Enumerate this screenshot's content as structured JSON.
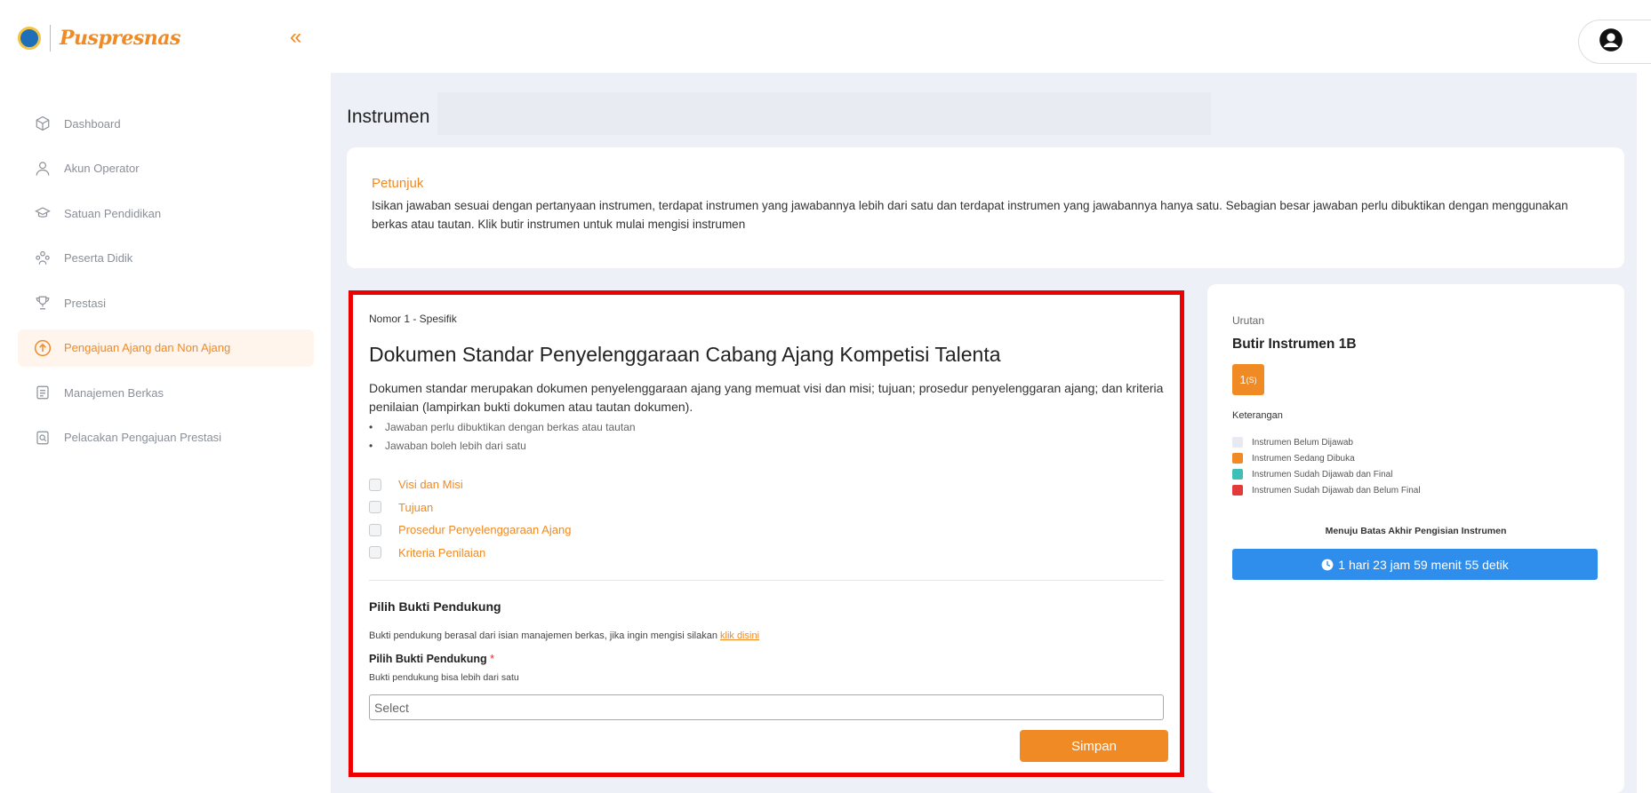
{
  "brand": {
    "name": "Puspresnas"
  },
  "nav": {
    "items": [
      {
        "label": "Dashboard",
        "icon": "cube-icon"
      },
      {
        "label": "Akun Operator",
        "icon": "user-icon"
      },
      {
        "label": "Satuan Pendidikan",
        "icon": "graduation-cap-icon"
      },
      {
        "label": "Peserta Didik",
        "icon": "users-icon"
      },
      {
        "label": "Prestasi",
        "icon": "trophy-icon"
      },
      {
        "label": "Pengajuan Ajang dan Non Ajang",
        "icon": "upload-icon",
        "active": true
      },
      {
        "label": "Manajemen Berkas",
        "icon": "document-icon"
      },
      {
        "label": "Pelacakan Pengajuan Prestasi",
        "icon": "search-document-icon"
      }
    ]
  },
  "page": {
    "title": "Instrumen"
  },
  "petunjuk": {
    "title": "Petunjuk",
    "body": "Isikan jawaban sesuai dengan pertanyaan instrumen, terdapat instrumen yang jawabannya lebih dari satu dan terdapat instrumen yang jawabannya hanya satu. Sebagian besar jawaban perlu dibuktikan dengan menggunakan berkas atau tautan. Klik butir instrumen untuk mulai mengisi instrumen"
  },
  "question": {
    "number": "Nomor 1 - Spesifik",
    "title": "Dokumen Standar Penyelenggaraan Cabang Ajang Kompetisi Talenta",
    "description": "Dokumen standar merupakan dokumen penyelenggaraan ajang yang memuat visi dan misi; tujuan; prosedur penyelenggaran ajang; dan kriteria penilaian (lampirkan bukti dokumen atau tautan dokumen).",
    "bullets": [
      "Jawaban perlu dibuktikan dengan berkas atau tautan",
      "Jawaban boleh lebih dari satu"
    ],
    "options": [
      "Visi dan Misi",
      "Tujuan",
      "Prosedur Penyelenggaraan Ajang",
      "Kriteria Penilaian"
    ]
  },
  "bukti": {
    "heading": "Pilih Bukti Pendukung",
    "info": "Bukti pendukung berasal dari isian manajemen berkas, jika ingin mengisi silakan ",
    "link": "klik disini",
    "label": "Pilih Bukti Pendukung",
    "required_mark": "*",
    "hint": "Bukti pendukung bisa lebih dari satu",
    "select_placeholder": "Select"
  },
  "save_label": "Simpan",
  "side": {
    "urutan_label": "Urutan",
    "butir_title": "Butir Instrumen 1B",
    "butir_main": "1",
    "butir_sub": "(S)",
    "keterangan_label": "Keterangan",
    "legend": [
      {
        "label": "Instrumen Belum Dijawab",
        "color": "#e8eaf2"
      },
      {
        "label": "Instrumen Sedang Dibuka",
        "color": "#f08a24"
      },
      {
        "label": "Instrumen Sudah Dijawab dan Final",
        "color": "#3fbfb5"
      },
      {
        "label": "Instrumen Sudah Dijawab dan Belum Final",
        "color": "#e23a3a"
      }
    ],
    "deadline_label": "Menuju Batas Akhir Pengisian Instrumen",
    "countdown": "1 hari 23 jam 59 menit 55 detik"
  },
  "colors": {
    "accent": "#f08a24",
    "info": "#2f8eec",
    "highlight_border": "#ee0000",
    "page_bg": "#eef0f8"
  }
}
